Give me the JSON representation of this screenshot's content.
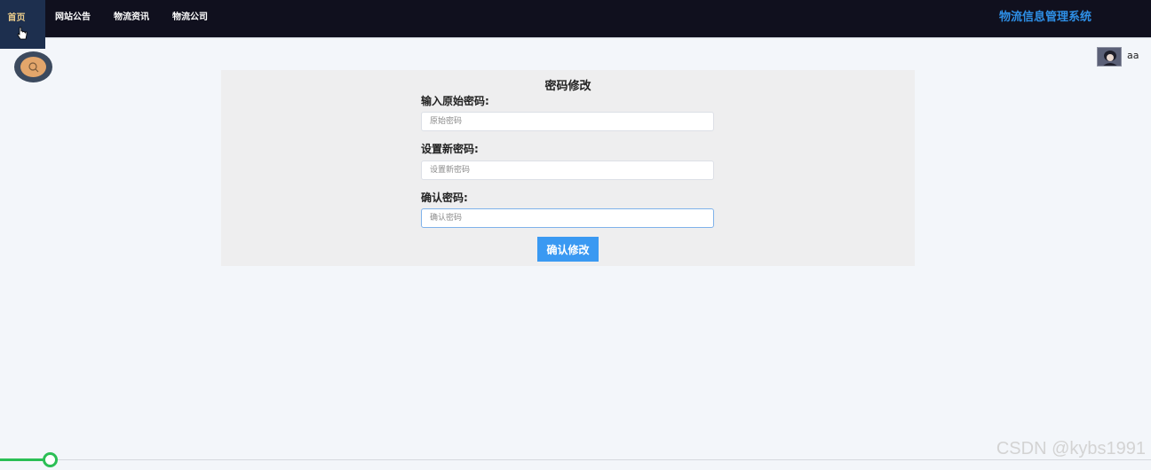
{
  "nav": {
    "home": "首页",
    "items": [
      {
        "label": "网站公告"
      },
      {
        "label": "物流资讯"
      },
      {
        "label": "物流公司"
      }
    ],
    "brand": "物流信息管理系统"
  },
  "user": {
    "name": "aa"
  },
  "form": {
    "title": "密码修改",
    "fields": [
      {
        "label": "输入原始密码:",
        "placeholder": "原始密码"
      },
      {
        "label": "设置新密码:",
        "placeholder": "设置新密码"
      },
      {
        "label": "确认密码:",
        "placeholder": "确认密码"
      }
    ],
    "submit_label": "确认修改"
  },
  "watermark": "CSDN @kybs1991",
  "colors": {
    "topbar": "#10101e",
    "brand": "#2e8fe6",
    "button": "#3a99f2",
    "progress": "#2bbf55"
  }
}
